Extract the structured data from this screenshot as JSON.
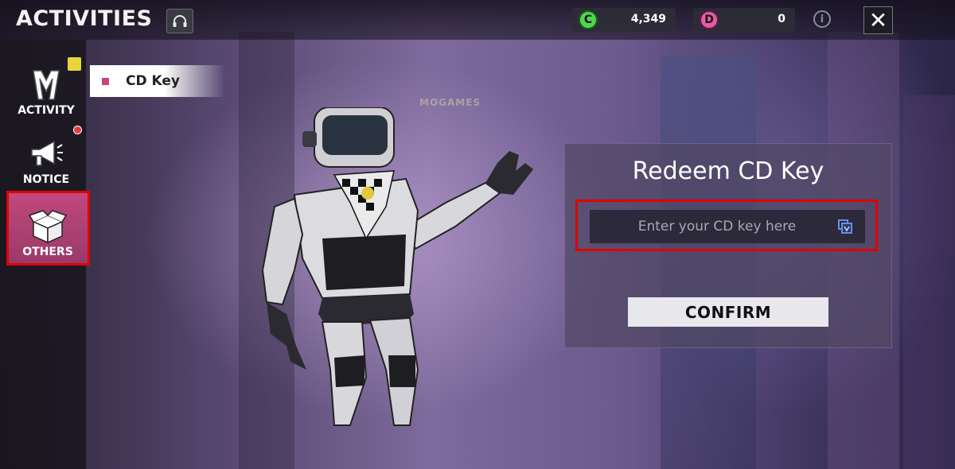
{
  "header": {
    "title": "ACTIVITIES",
    "currency_green": {
      "icon": "c-coin-icon",
      "value": "4,349",
      "color": "#4fd64f"
    },
    "currency_pink": {
      "icon": "d-coin-icon",
      "value": "0",
      "color": "#e85aa8"
    }
  },
  "sidebar": {
    "items": [
      {
        "label": "ACTIVITY",
        "icon": "activity-logo-icon",
        "selected": false
      },
      {
        "label": "NOTICE",
        "icon": "megaphone-icon",
        "selected": false
      },
      {
        "label": "OTHERS",
        "icon": "box-icon",
        "selected": true
      }
    ]
  },
  "tab": {
    "label": "CD Key"
  },
  "watermark": "MOGAMES",
  "redeem": {
    "title": "Redeem CD Key",
    "input_placeholder": "Enter your CD key here",
    "input_value": "",
    "confirm_label": "CONFIRM"
  },
  "colors": {
    "accent": "#c0487c",
    "highlight": "#e10000"
  }
}
